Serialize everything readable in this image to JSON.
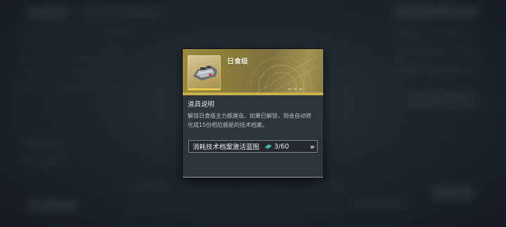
{
  "tooltip": {
    "item_name": "日食级",
    "section_title": "道具说明",
    "description": "解锁日食级主力舰建造，如果已解锁，则会自动转化成15份相应舰船的技术档案。",
    "item_icon": "battleship-blueprint-icon"
  },
  "activation": {
    "label": "消耗技术档案激活蓝图",
    "cost_icon": "tech-archive-icon",
    "cost_value": "3/60",
    "arrow_icon": "double-chevron-right-icon"
  },
  "colors": {
    "header_gold": "#9c8a3c",
    "panel_bg": "#2f353d",
    "accent_bar": "#e8c74a",
    "archive_icon_teal": "#3fb9a8"
  }
}
